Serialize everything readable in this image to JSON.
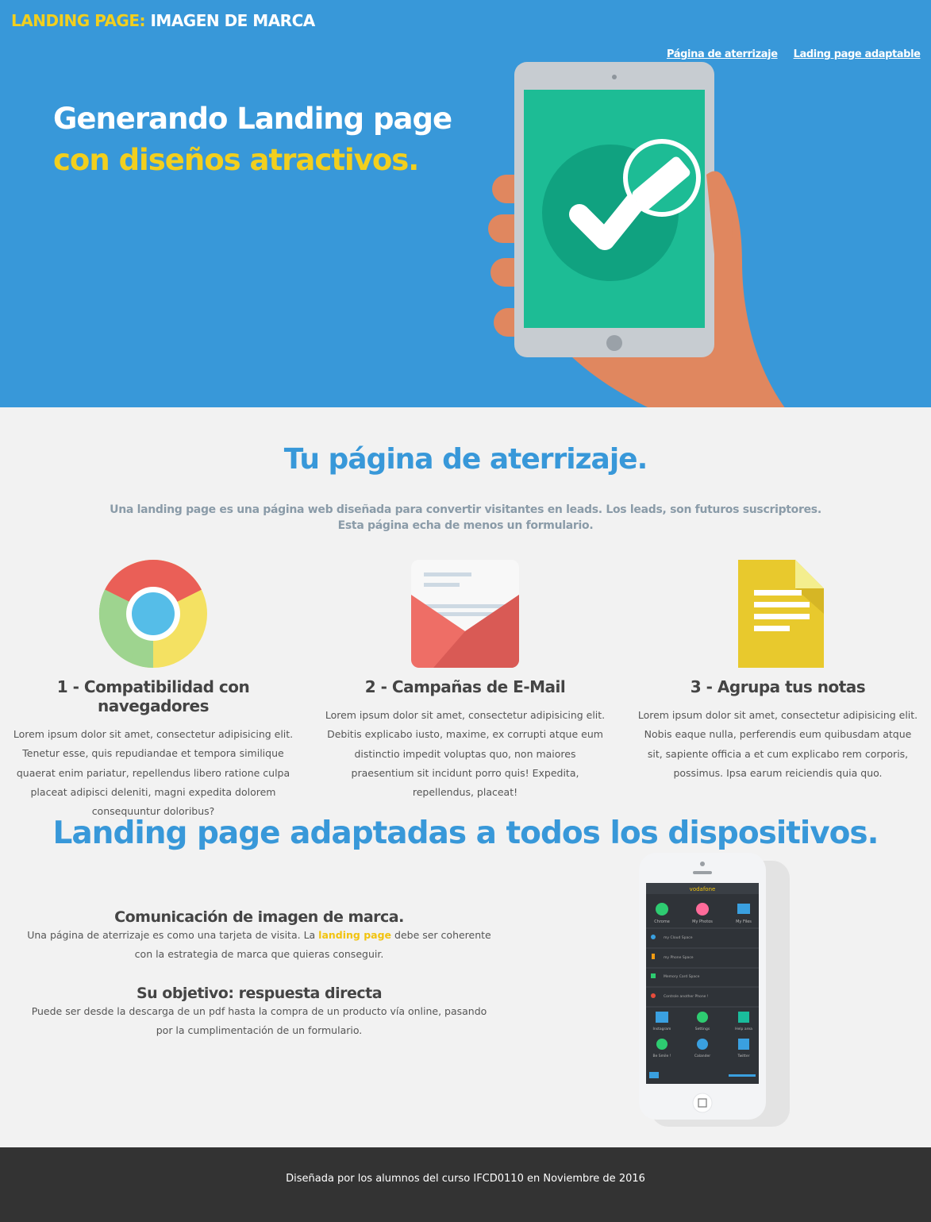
{
  "header": {
    "brand_highlight": "LANDING PAGE:",
    "brand_rest": "IMAGEN DE MARCA",
    "nav": [
      "Página de aterrizaje",
      "Lading page adaptable"
    ]
  },
  "hero": {
    "line1": "Generando Landing page",
    "line2": "con diseños atractivos."
  },
  "section1": {
    "title": "Tu página de aterrizaje.",
    "lead_line1": "Una landing page es una página web diseñada para convertir visitantes en leads. Los leads, son futuros suscriptores.",
    "lead_line2": "Esta página echa de menos un formulario.",
    "features": [
      {
        "icon": "browser-icon",
        "title": "1 - Compatibilidad con navegadores",
        "text": "Lorem ipsum dolor sit amet, consectetur adipisicing elit. Tenetur esse, quis repudiandae et tempora similique quaerat enim pariatur, repellendus libero ratione culpa placeat adipisci deleniti, magni expedita dolorem consequuntur doloribus?"
      },
      {
        "icon": "envelope-icon",
        "title": "2 - Campañas de E-Mail",
        "text": "Lorem ipsum dolor sit amet, consectetur adipisicing elit. Debitis explicabo iusto, maxime, ex corrupti atque eum distinctio impedit voluptas quo, non maiores praesentium sit incidunt porro quis! Expedita, repellendus, placeat!"
      },
      {
        "icon": "document-icon",
        "title": "3 - Agrupa tus notas",
        "text": "Lorem ipsum dolor sit amet, consectetur adipisicing elit. Nobis eaque nulla, perferendis eum quibusdam atque sit, sapiente officia a et cum explicabo rem corporis, possimus. Ipsa earum reiciendis quia quo."
      }
    ]
  },
  "section2": {
    "title": "Landing page adaptadas a todos los dispositivos.",
    "block1_title": "Comunicación de imagen de marca.",
    "block1_text_before": "Una página de aterrizaje es como una tarjeta de visita. La ",
    "block1_highlight": "landing page",
    "block1_text_after": " debe ser coherente con la estrategia de marca que quieras conseguir.",
    "block2_title": "Su objetivo: respuesta directa",
    "block2_text": "Puede ser desde la descarga de un pdf hasta la compra de un producto vía online, pasando por la cumplimentación de un formulario.",
    "phone": {
      "carrier": "vodafone",
      "top_apps": [
        "Chrome",
        "My Photos",
        "My Files"
      ],
      "list": [
        "my Cloud Space",
        "my Phone Space",
        "Memory Card Space",
        "Controle another Phone !"
      ],
      "grid_row1": [
        "Instagram",
        "Settings",
        "Help area"
      ],
      "grid_row2": [
        "Be Smile !",
        "Calander",
        "Twitter"
      ]
    }
  },
  "footer": {
    "text": "Diseñada por los alumnos del curso IFCD0110 en Noviembre de 2016"
  },
  "colors": {
    "hero_bg": "#3898d9",
    "accent_yellow": "#f2cf1e",
    "title_blue": "#3898d9",
    "footer_bg": "#333333",
    "page_bg": "#f2f2f2"
  }
}
